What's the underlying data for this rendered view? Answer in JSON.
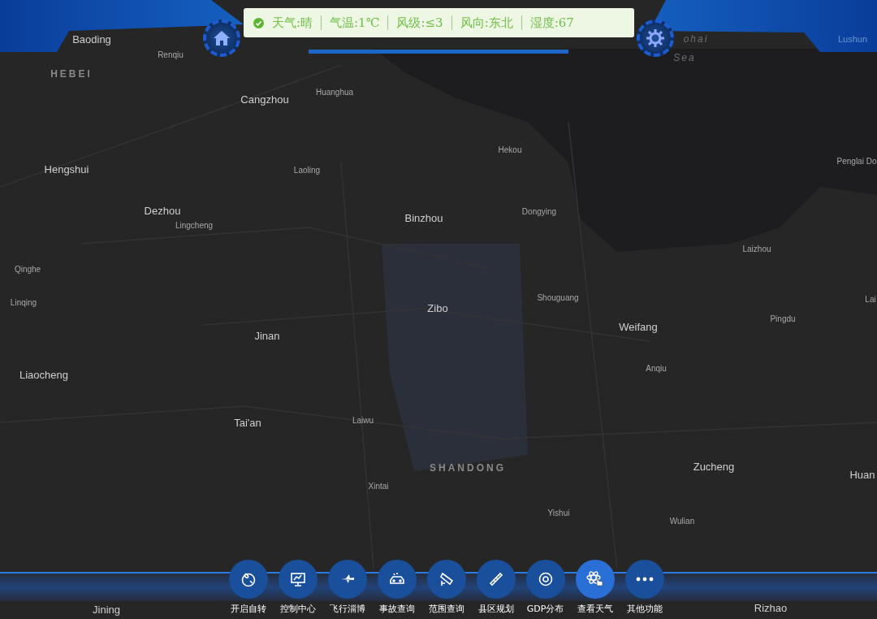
{
  "map": {
    "labels": [
      {
        "text": "Baoding",
        "kind": "city"
      },
      {
        "text": "Renqiu",
        "kind": "town"
      },
      {
        "text": "HEBEI",
        "kind": "region"
      },
      {
        "text": "Cangzhou",
        "kind": "city"
      },
      {
        "text": "Huanghua",
        "kind": "town"
      },
      {
        "text": "Hengshui",
        "kind": "city"
      },
      {
        "text": "Laoling",
        "kind": "town"
      },
      {
        "text": "Hekou",
        "kind": "town"
      },
      {
        "text": "Penglai Do",
        "kind": "town"
      },
      {
        "text": "Dezhou",
        "kind": "city"
      },
      {
        "text": "Lingcheng",
        "kind": "town"
      },
      {
        "text": "Binzhou",
        "kind": "city"
      },
      {
        "text": "Dongying",
        "kind": "town"
      },
      {
        "text": "Qinghe",
        "kind": "town"
      },
      {
        "text": "Laizhou",
        "kind": "town"
      },
      {
        "text": "Linqing",
        "kind": "town"
      },
      {
        "text": "Shouguang",
        "kind": "town"
      },
      {
        "text": "Zibo",
        "kind": "city"
      },
      {
        "text": "Pingdu",
        "kind": "town"
      },
      {
        "text": "Lai",
        "kind": "town"
      },
      {
        "text": "Jinan",
        "kind": "city"
      },
      {
        "text": "Weifang",
        "kind": "city"
      },
      {
        "text": "Anqiu",
        "kind": "town"
      },
      {
        "text": "Liaocheng",
        "kind": "city"
      },
      {
        "text": "Tai'an",
        "kind": "city"
      },
      {
        "text": "Laiwu",
        "kind": "town"
      },
      {
        "text": "SHANDONG",
        "kind": "region"
      },
      {
        "text": "Zucheng",
        "kind": "city"
      },
      {
        "text": "Huan",
        "kind": "city"
      },
      {
        "text": "Xintai",
        "kind": "town"
      },
      {
        "text": "Yishui",
        "kind": "town"
      },
      {
        "text": "Wulian",
        "kind": "town"
      },
      {
        "text": "Jining",
        "kind": "city"
      },
      {
        "text": "Rizhao",
        "kind": "city"
      },
      {
        "text": "ohai",
        "kind": "sea"
      },
      {
        "text": "Sea",
        "kind": "sea"
      },
      {
        "text": "Lushun",
        "kind": "faint"
      }
    ]
  },
  "weather": {
    "items": [
      "天气:晴",
      "气温:1℃",
      "风级:≤3",
      "风向:东北",
      "湿度:67"
    ]
  },
  "toolbar": [
    {
      "label": "开启自转",
      "selected": false
    },
    {
      "label": "控制中心",
      "selected": false
    },
    {
      "label": "飞行淄博",
      "selected": false
    },
    {
      "label": "事故查询",
      "selected": false
    },
    {
      "label": "范围查询",
      "selected": false
    },
    {
      "label": "县区规划",
      "selected": false
    },
    {
      "label": "GDP分布",
      "selected": false
    },
    {
      "label": "查看天气",
      "selected": true
    },
    {
      "label": "其他功能",
      "selected": false
    }
  ]
}
